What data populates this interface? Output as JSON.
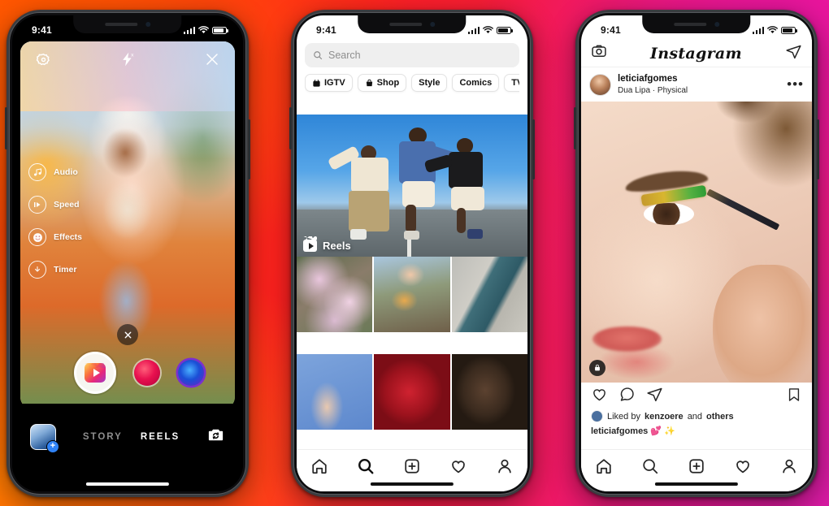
{
  "background": {
    "colors": [
      "#ff4d00",
      "#ff2020",
      "#e6168f",
      "#d81ba4"
    ]
  },
  "phones": {
    "left": {
      "name": "instagram-reels-camera",
      "status_bar": {
        "time": "9:41",
        "signal_icon": "signal-bars-icon",
        "wifi_icon": "wifi-icon",
        "battery_icon": "battery-icon"
      },
      "top_controls": [
        {
          "name": "settings-icon",
          "label": "Settings"
        },
        {
          "name": "flash-off-icon",
          "label": "Flash off"
        },
        {
          "name": "close-icon",
          "label": "Close"
        }
      ],
      "tools": [
        {
          "icon": "audio-icon",
          "label": "Audio"
        },
        {
          "icon": "speed-icon",
          "label": "Speed"
        },
        {
          "icon": "effects-icon",
          "label": "Effects"
        },
        {
          "icon": "timer-icon",
          "label": "Timer"
        }
      ],
      "dismiss_label": "×",
      "shutter": {
        "name": "record-button",
        "icon": "reels-icon"
      },
      "effects": [
        {
          "name": "effect-thumb-red",
          "color": "#e8114f"
        },
        {
          "name": "effect-thumb-blue",
          "color": "#1a4fd6"
        }
      ],
      "bottom": {
        "gallery_icon": "gallery-thumbnail-icon",
        "modes": [
          {
            "label": "STORY",
            "active": false
          },
          {
            "label": "REELS",
            "active": true
          }
        ],
        "flip_camera_icon": "flip-camera-icon"
      }
    },
    "middle": {
      "name": "instagram-explore",
      "status_bar": {
        "time": "9:41"
      },
      "search": {
        "placeholder": "Search",
        "icon": "search-icon"
      },
      "filter_pills": [
        {
          "label": "IGTV",
          "icon": "igtv-icon"
        },
        {
          "label": "Shop",
          "icon": "shop-bag-icon"
        },
        {
          "label": "Style",
          "icon": ""
        },
        {
          "label": "Comics",
          "icon": ""
        },
        {
          "label": "TV & Movies",
          "icon": ""
        }
      ],
      "hero": {
        "label": "Reels",
        "icon": "reels-clapper-icon",
        "alt": "Three dancers on a road"
      },
      "grid": [
        {
          "name": "grid-cell-flowers"
        },
        {
          "name": "grid-cell-family"
        },
        {
          "name": "grid-cell-skateboard"
        },
        {
          "name": "grid-cell-hands-blue"
        },
        {
          "name": "grid-cell-red-dress"
        },
        {
          "name": "grid-cell-portrait"
        }
      ],
      "tabbar": [
        {
          "name": "tab-home",
          "icon": "home-icon",
          "active": false
        },
        {
          "name": "tab-search",
          "icon": "search-icon",
          "active": true
        },
        {
          "name": "tab-add",
          "icon": "plus-square-icon",
          "active": false
        },
        {
          "name": "tab-activity",
          "icon": "heart-icon",
          "active": false
        },
        {
          "name": "tab-profile",
          "icon": "person-icon",
          "active": false
        }
      ]
    },
    "right": {
      "name": "instagram-feed",
      "status_bar": {
        "time": "9:41"
      },
      "header": {
        "camera_icon": "camera-icon",
        "title": "Instagram",
        "direct_icon": "send-paper-plane-icon"
      },
      "post": {
        "username": "leticiafgomes",
        "audio": "Dua Lipa · Physical",
        "more_icon": "more-options-icon",
        "audio_badge_icon": "audio-badge-icon",
        "image_alt": "Close-up of glitter eyeliner makeup application",
        "actions": [
          {
            "name": "like-button",
            "icon": "heart-icon"
          },
          {
            "name": "comment-button",
            "icon": "comment-icon"
          },
          {
            "name": "share-button",
            "icon": "send-paper-plane-icon"
          },
          {
            "name": "save-button",
            "icon": "bookmark-icon"
          }
        ],
        "likes_prefix": "Liked by",
        "likes_user": "kenzoere",
        "likes_suffix": "and",
        "likes_others": "others",
        "caption_user": "leticiafgomes",
        "caption_text": "💕 ✨"
      },
      "tabbar": [
        {
          "name": "tab-home",
          "icon": "home-icon",
          "active": false
        },
        {
          "name": "tab-search",
          "icon": "search-icon",
          "active": false
        },
        {
          "name": "tab-add",
          "icon": "plus-square-icon",
          "active": false
        },
        {
          "name": "tab-activity",
          "icon": "heart-icon",
          "active": false
        },
        {
          "name": "tab-profile",
          "icon": "person-icon",
          "active": false
        }
      ]
    }
  }
}
